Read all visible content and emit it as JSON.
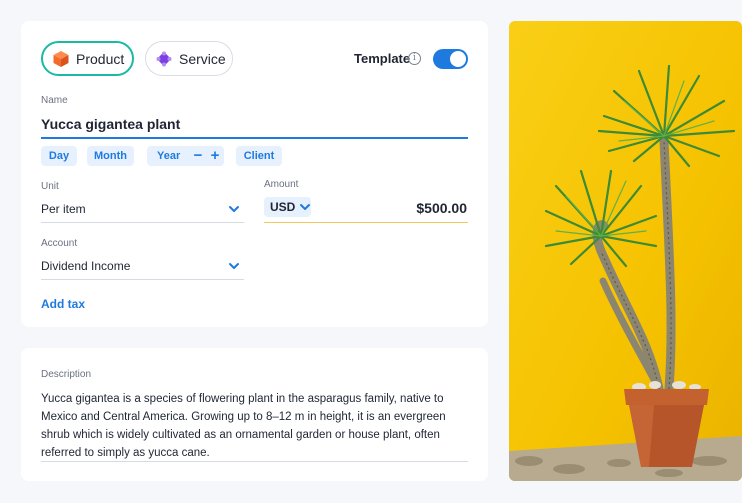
{
  "type_selector": {
    "product_label": "Product",
    "service_label": "Service"
  },
  "template": {
    "label": "Template",
    "info_glyph": "i",
    "enabled": true
  },
  "name_field": {
    "label": "Name",
    "value": "Yucca gigantea plant"
  },
  "period_chips": {
    "day": "Day",
    "month": "Month",
    "year": "Year",
    "minus": "−",
    "plus": "+",
    "client": "Client"
  },
  "unit_field": {
    "label": "Unit",
    "value": "Per item"
  },
  "amount_field": {
    "label": "Amount",
    "currency": "USD",
    "value": "$500.00"
  },
  "account_field": {
    "label": "Account",
    "value": "Dividend Income"
  },
  "add_tax_label": "Add tax",
  "description": {
    "label": "Description",
    "text": "Yucca gigantea is a species of flowering plant in the asparagus family, native to Mexico and Central America. Growing up to 8–12 m in height, it is an evergreen shrub which is widely cultivated as an ornamental garden or house plant, often referred to simply as yucca cane."
  },
  "colors": {
    "accent": "#1f7ae0",
    "product_outline": "#19b9a4",
    "product_icon": "#f26b2d",
    "service_icon": "#7b3fe4",
    "photo_background": "#f7c60a"
  },
  "icons": {
    "product": "box-icon",
    "service": "diamond-icon",
    "info": "info-icon",
    "dropdown": "chevron-down-icon"
  }
}
